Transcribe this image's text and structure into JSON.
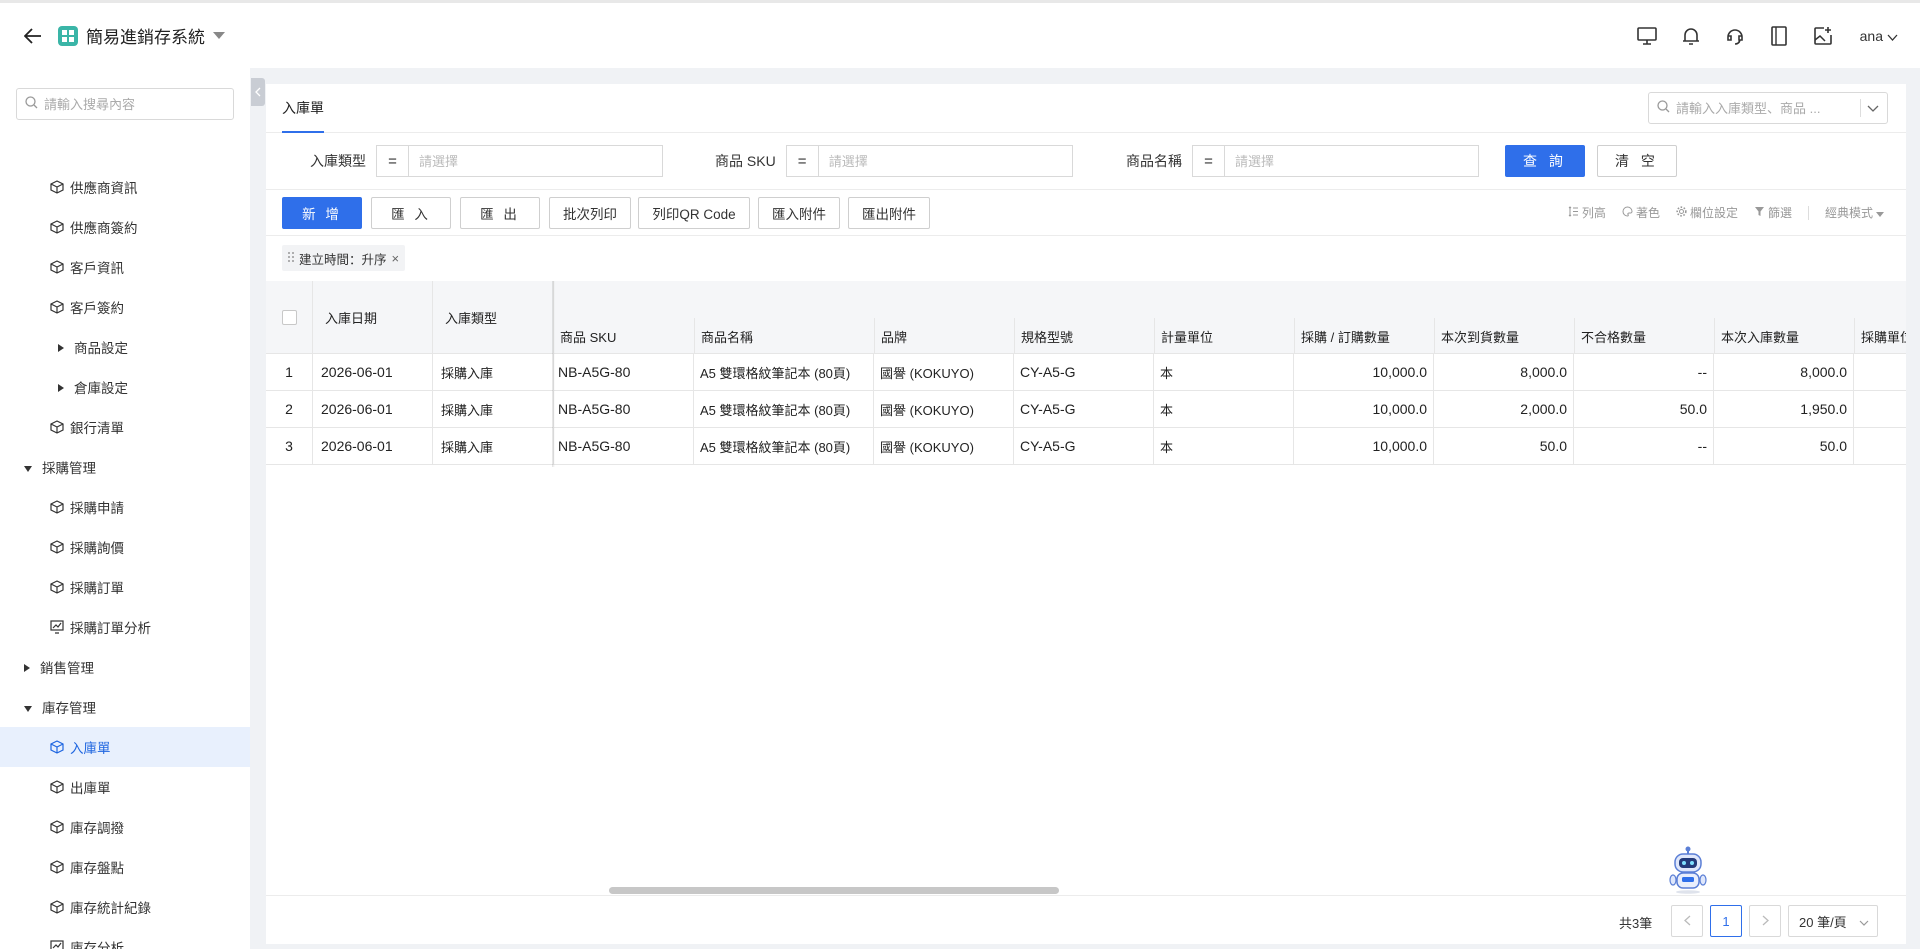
{
  "header": {
    "app_title": "簡易進銷存系統",
    "user_name": "ana",
    "icons": [
      "back-arrow-icon",
      "app-grid-icon",
      "caret-down-icon",
      "monitor-icon",
      "bell-icon",
      "headset-icon",
      "book-icon",
      "image-add-icon",
      "chevron-down-icon"
    ]
  },
  "sidebar": {
    "search_placeholder": "請輸入搜尋內容",
    "items": [
      {
        "label": "供應商資訊"
      },
      {
        "label": "供應商簽約"
      },
      {
        "label": "客戶資訊"
      },
      {
        "label": "客戶簽約"
      },
      {
        "label": "商品設定"
      },
      {
        "label": "倉庫設定"
      },
      {
        "label": "銀行清單"
      },
      {
        "label": "採購管理"
      },
      {
        "label": "採購申請"
      },
      {
        "label": "採購詢價"
      },
      {
        "label": "採購訂單"
      },
      {
        "label": "採購訂單分析"
      },
      {
        "label": "銷售管理"
      },
      {
        "label": "庫存管理"
      },
      {
        "label": "入庫單"
      },
      {
        "label": "出庫單"
      },
      {
        "label": "庫存調撥"
      },
      {
        "label": "庫存盤點"
      },
      {
        "label": "庫存統計紀錄"
      },
      {
        "label": "庫存分析"
      }
    ]
  },
  "main": {
    "tab": "入庫單",
    "top_search_placeholder": "請輸入入庫類型、商品 ...",
    "filters": [
      {
        "label": "入庫類型",
        "op": "=",
        "placeholder": "請選擇"
      },
      {
        "label": "商品 SKU",
        "op": "=",
        "placeholder": "請選擇"
      },
      {
        "label": "商品名稱",
        "op": "=",
        "placeholder": "請選擇"
      }
    ],
    "query_label": "查 詢",
    "clear_label": "清 空",
    "toolbar": {
      "buttons": [
        "新 增",
        "匯 入",
        "匯 出",
        "批次列印",
        "列印QR Code",
        "匯入附件",
        "匯出附件"
      ],
      "right": [
        "列高",
        "著色",
        "欄位設定",
        "篩選",
        "經典模式"
      ]
    },
    "sort_chip": "建立時間：升序",
    "accent_color": "#2f6fea"
  },
  "table": {
    "fixed_headers": [
      "入庫日期",
      "入庫類型"
    ],
    "headers": [
      "商品 SKU",
      "商品名稱",
      "品牌",
      "規格型號",
      "計量單位",
      "採購 / 訂購數量",
      "本次到貨數量",
      "不合格數量",
      "本次入庫數量",
      "採購單位"
    ],
    "rows": [
      {
        "idx": "1",
        "date": "2026-06-01",
        "type": "採購入庫",
        "sku": "NB-A5G-80",
        "name": "A5 雙環格紋筆記本 (80頁)",
        "brand": "國譽 (KOKUYO)",
        "spec": "CY-A5-G",
        "unit": "本",
        "order_qty": "10,000.0",
        "arrive_qty": "8,000.0",
        "bad_qty": "--",
        "in_qty": "8,000.0"
      },
      {
        "idx": "2",
        "date": "2026-06-01",
        "type": "採購入庫",
        "sku": "NB-A5G-80",
        "name": "A5 雙環格紋筆記本 (80頁)",
        "brand": "國譽 (KOKUYO)",
        "spec": "CY-A5-G",
        "unit": "本",
        "order_qty": "10,000.0",
        "arrive_qty": "2,000.0",
        "bad_qty": "50.0",
        "in_qty": "1,950.0"
      },
      {
        "idx": "3",
        "date": "2026-06-01",
        "type": "採購入庫",
        "sku": "NB-A5G-80",
        "name": "A5 雙環格紋筆記本 (80頁)",
        "brand": "國譽 (KOKUYO)",
        "spec": "CY-A5-G",
        "unit": "本",
        "order_qty": "10,000.0",
        "arrive_qty": "50.0",
        "bad_qty": "--",
        "in_qty": "50.0"
      }
    ]
  },
  "pager": {
    "total": "共3筆",
    "current_page": "1",
    "page_size": "20 筆/頁"
  }
}
